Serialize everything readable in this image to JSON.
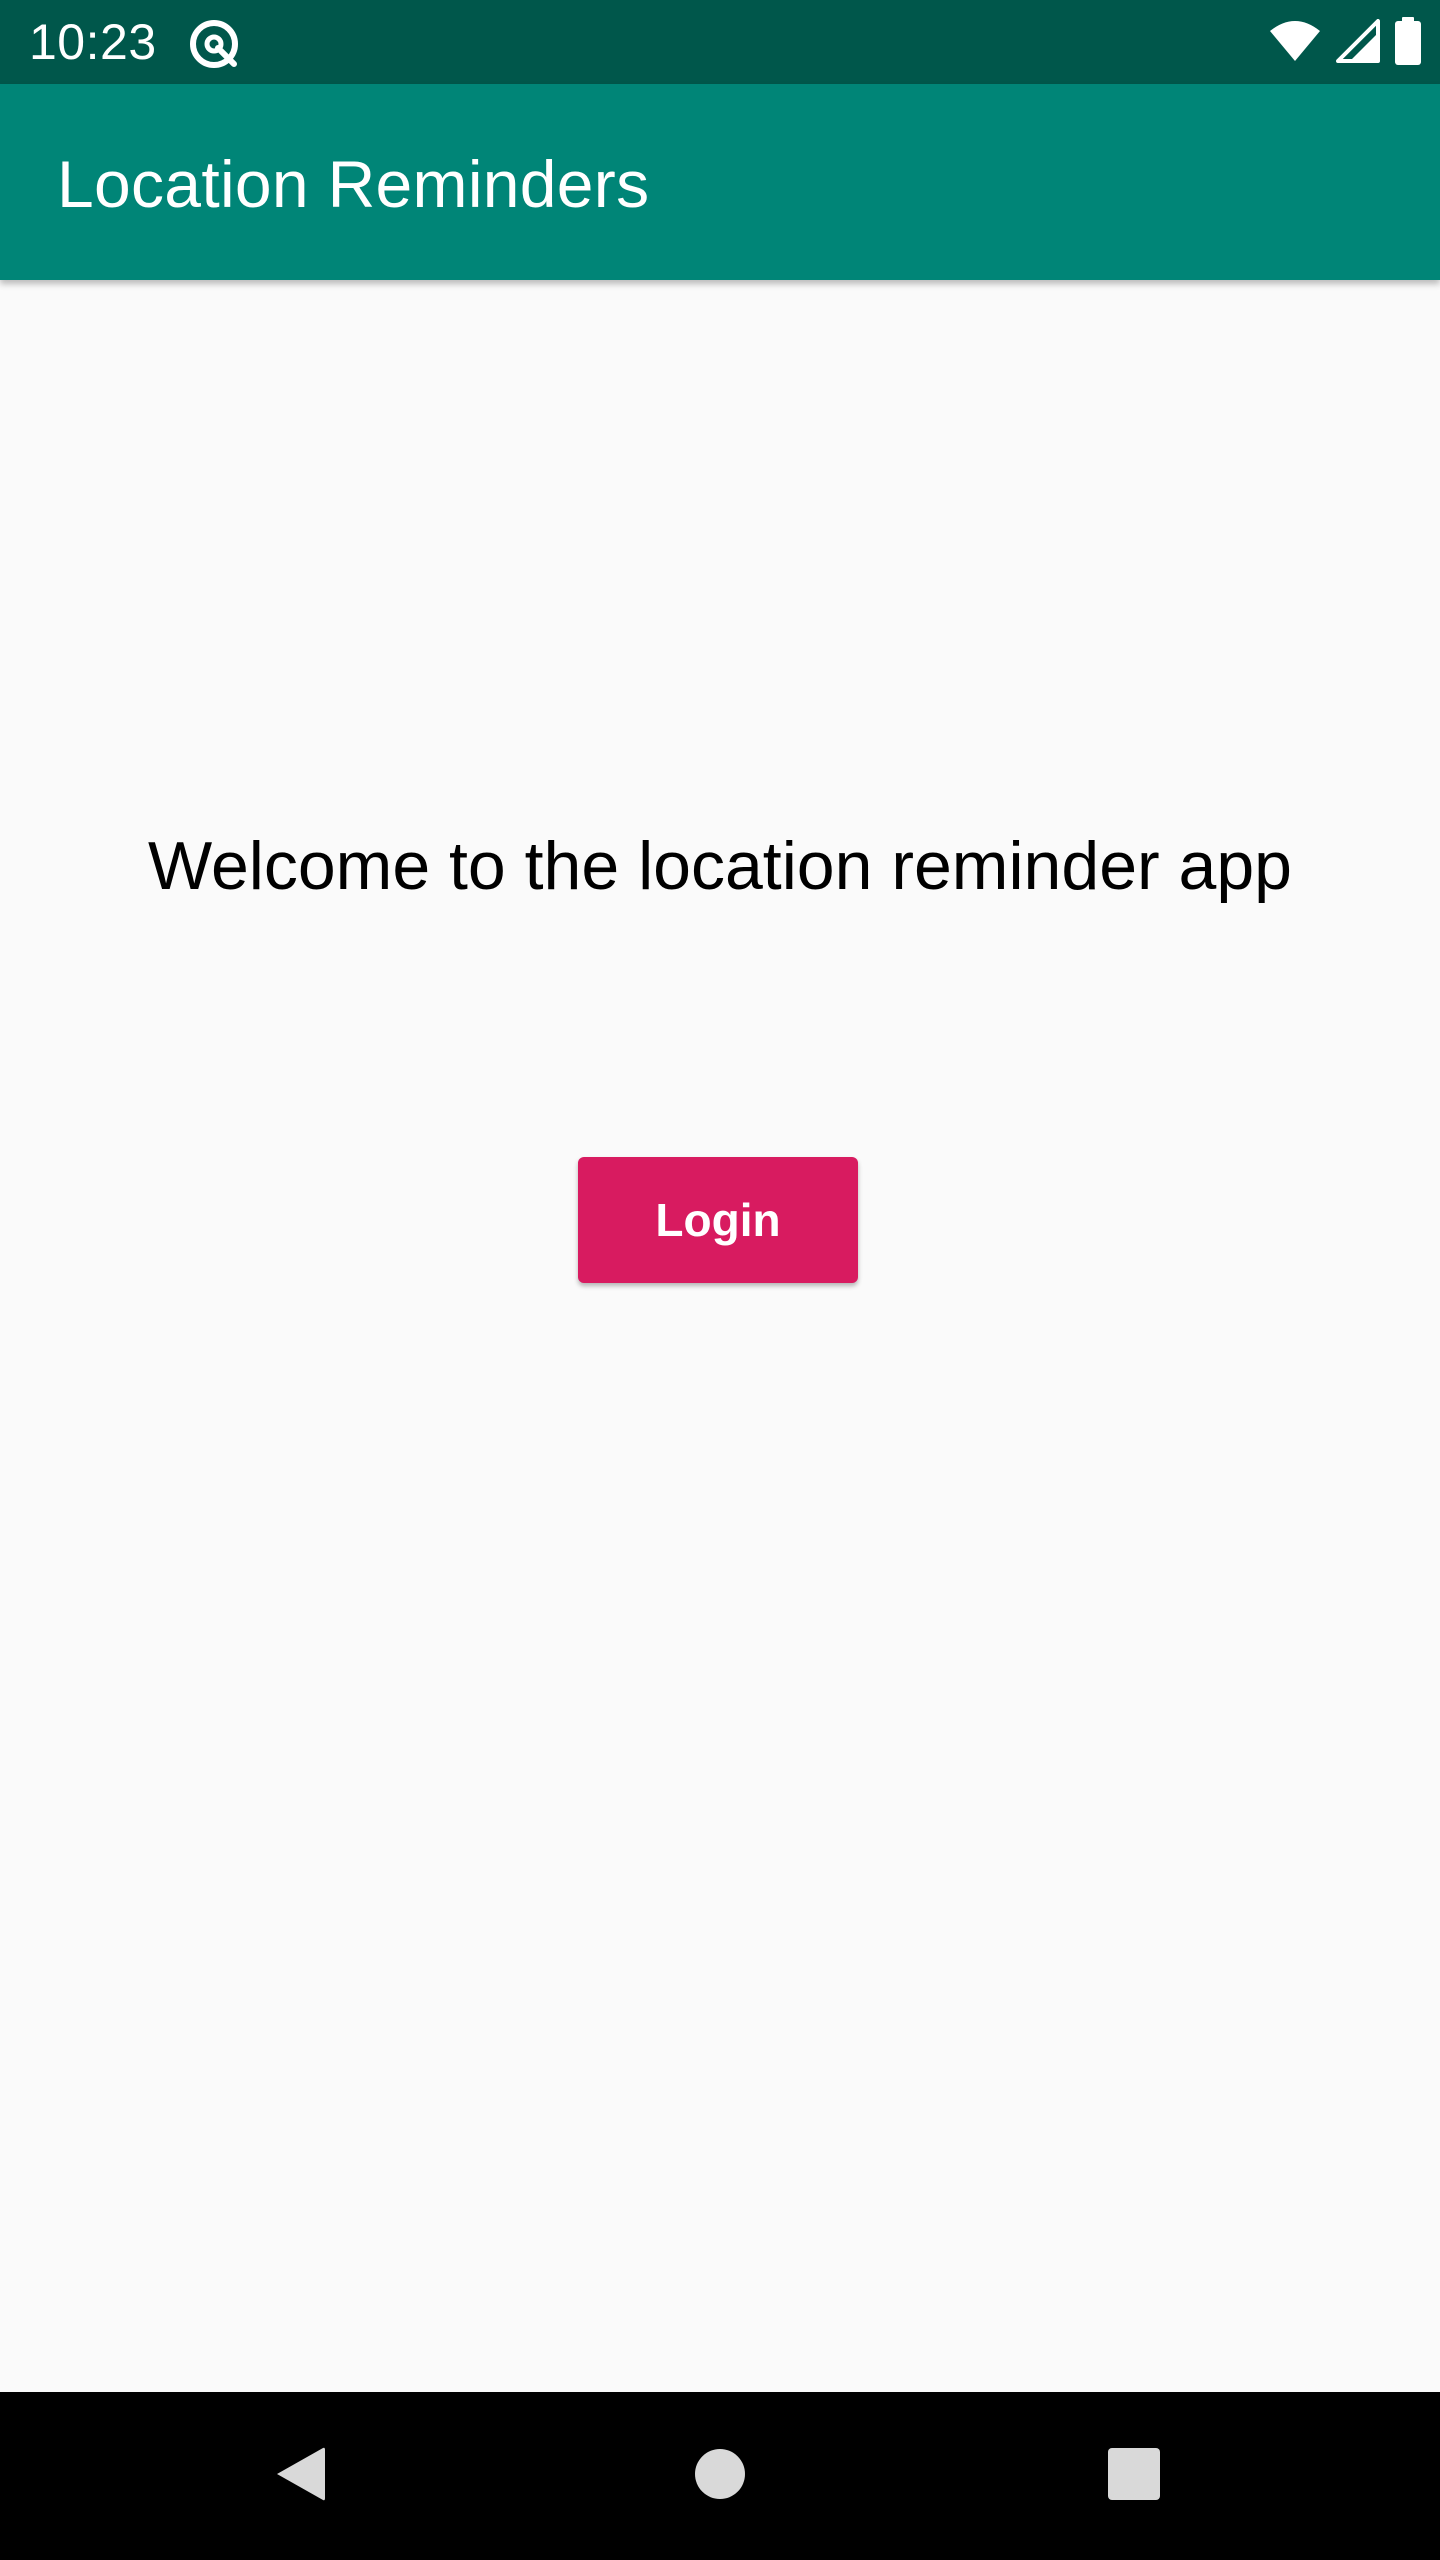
{
  "status_bar": {
    "time": "10:23",
    "app_icon": "at-sign-icon",
    "icons": [
      "wifi-icon",
      "cell-signal-icon",
      "battery-icon"
    ],
    "color": "#00574b"
  },
  "app_bar": {
    "title": "Location Reminders",
    "color": "#008577"
  },
  "main": {
    "welcome_text": "Welcome to the location reminder app",
    "login_button_label": "Login",
    "accent_color": "#d81b60"
  },
  "nav_bar": {
    "buttons": [
      "back-icon",
      "home-icon",
      "recents-icon"
    ]
  }
}
